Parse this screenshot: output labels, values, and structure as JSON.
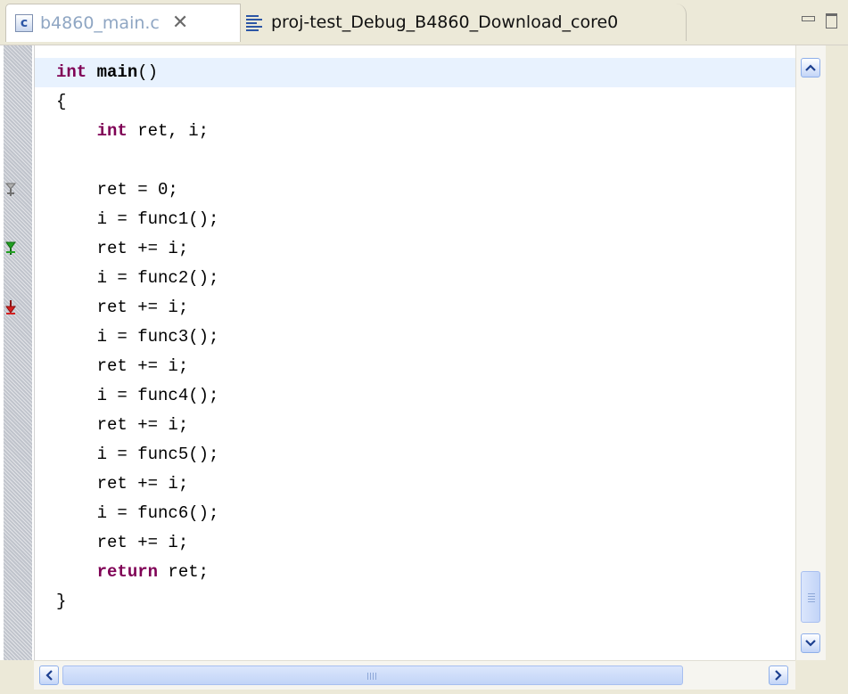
{
  "tabs": [
    {
      "label": "b4860_main.c",
      "icon": "c-source-file-icon",
      "active": true,
      "close_glyph": "✕"
    },
    {
      "label": "proj-test_Debug_B4860_Download_core0",
      "icon": "disassembly-lines-icon",
      "active": false
    }
  ],
  "window_controls": {
    "minimize_icon": "minimize-icon",
    "maximize_icon": "maximize-icon"
  },
  "editor": {
    "code_lines": [
      {
        "indent": "",
        "parts": [
          {
            "t": "int",
            "k": "kw"
          },
          {
            "t": " "
          },
          {
            "t": "main",
            "k": "fn"
          },
          {
            "t": "()"
          }
        ]
      },
      {
        "indent": "",
        "parts": [
          {
            "t": "{"
          }
        ]
      },
      {
        "indent": "    ",
        "parts": [
          {
            "t": "int",
            "k": "kw"
          },
          {
            "t": " ret, i;"
          }
        ]
      },
      {
        "indent": "",
        "parts": [
          {
            "t": ""
          }
        ]
      },
      {
        "indent": "    ",
        "parts": [
          {
            "t": "ret = 0;"
          }
        ]
      },
      {
        "indent": "    ",
        "parts": [
          {
            "t": "i = func1();"
          }
        ]
      },
      {
        "indent": "    ",
        "parts": [
          {
            "t": "ret += i;"
          }
        ]
      },
      {
        "indent": "    ",
        "parts": [
          {
            "t": "i = func2();"
          }
        ]
      },
      {
        "indent": "    ",
        "parts": [
          {
            "t": "ret += i;"
          }
        ]
      },
      {
        "indent": "    ",
        "parts": [
          {
            "t": "i = func3();"
          }
        ]
      },
      {
        "indent": "    ",
        "parts": [
          {
            "t": "ret += i;"
          }
        ]
      },
      {
        "indent": "    ",
        "parts": [
          {
            "t": "i = func4();"
          }
        ]
      },
      {
        "indent": "    ",
        "parts": [
          {
            "t": "ret += i;"
          }
        ]
      },
      {
        "indent": "    ",
        "parts": [
          {
            "t": "i = func5();"
          }
        ]
      },
      {
        "indent": "    ",
        "parts": [
          {
            "t": "ret += i;"
          }
        ]
      },
      {
        "indent": "    ",
        "parts": [
          {
            "t": "i = func6();"
          }
        ]
      },
      {
        "indent": "    ",
        "parts": [
          {
            "t": "ret += i;"
          }
        ]
      },
      {
        "indent": "    ",
        "parts": [
          {
            "t": "return",
            "k": "kw"
          },
          {
            "t": " ret;"
          }
        ]
      },
      {
        "indent": "",
        "parts": [
          {
            "t": "}"
          }
        ]
      }
    ],
    "markers": [
      {
        "line_index": 4,
        "icon": "trace-point-disabled-icon",
        "color": "#b0b0b0"
      },
      {
        "line_index": 6,
        "icon": "trace-point-start-icon",
        "color": "#22a022"
      },
      {
        "line_index": 8,
        "icon": "trace-point-stop-icon",
        "color": "#d42020"
      }
    ],
    "keyword_color": "#7f0055",
    "current_line_color": "#e8f2fe"
  },
  "scrollbars": {
    "vertical": {
      "up_icon": "scroll-up-arrow-icon",
      "down_icon": "scroll-down-arrow-icon",
      "position": 0.88
    },
    "horizontal": {
      "left_icon": "scroll-left-arrow-icon",
      "right_icon": "scroll-right-arrow-icon",
      "position": 0.0
    }
  }
}
